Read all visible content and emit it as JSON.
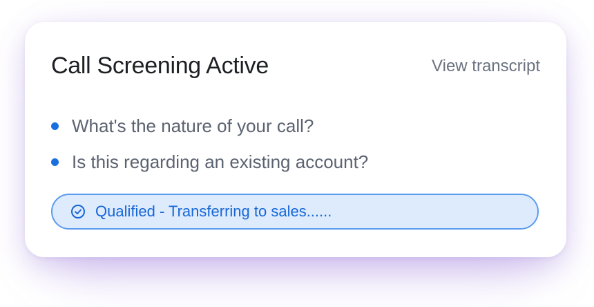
{
  "card": {
    "title": "Call Screening Active",
    "view_transcript_label": "View transcript",
    "questions": [
      "What's the nature of your call?",
      "Is this regarding an existing account?"
    ],
    "status": {
      "label": "Qualified - Transferring to sales......",
      "icon": "check-circle-icon"
    }
  },
  "colors": {
    "accent": "#1a6fe0",
    "status_bg": "#ddebfd",
    "status_border": "#5a9bf0",
    "title": "#1d1f24",
    "muted": "#6b7280"
  }
}
